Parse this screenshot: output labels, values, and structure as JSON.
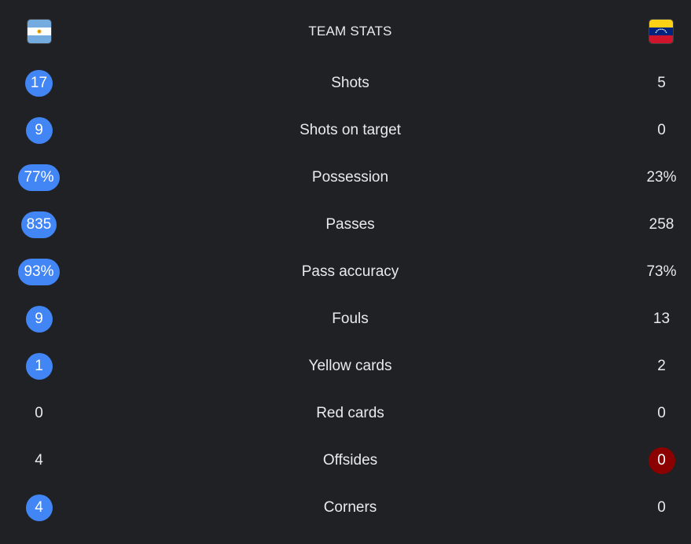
{
  "header": {
    "title": "TEAM STATS",
    "home_flag": "argentina-flag",
    "away_flag": "venezuela-flag"
  },
  "colors": {
    "background": "#202124",
    "text": "#e8eaed",
    "highlight_blue": "#4285f4",
    "highlight_red": "#8b0000"
  },
  "stats": [
    {
      "label": "Shots",
      "home": "17",
      "away": "5",
      "highlight": "home",
      "highlight_color": "blue"
    },
    {
      "label": "Shots on target",
      "home": "9",
      "away": "0",
      "highlight": "home",
      "highlight_color": "blue"
    },
    {
      "label": "Possession",
      "home": "77%",
      "away": "23%",
      "highlight": "home",
      "highlight_color": "blue"
    },
    {
      "label": "Passes",
      "home": "835",
      "away": "258",
      "highlight": "home",
      "highlight_color": "blue"
    },
    {
      "label": "Pass accuracy",
      "home": "93%",
      "away": "73%",
      "highlight": "home",
      "highlight_color": "blue"
    },
    {
      "label": "Fouls",
      "home": "9",
      "away": "13",
      "highlight": "home",
      "highlight_color": "blue"
    },
    {
      "label": "Yellow cards",
      "home": "1",
      "away": "2",
      "highlight": "home",
      "highlight_color": "blue"
    },
    {
      "label": "Red cards",
      "home": "0",
      "away": "0",
      "highlight": "none",
      "highlight_color": ""
    },
    {
      "label": "Offsides",
      "home": "4",
      "away": "0",
      "highlight": "away",
      "highlight_color": "red"
    },
    {
      "label": "Corners",
      "home": "4",
      "away": "0",
      "highlight": "home",
      "highlight_color": "blue"
    }
  ]
}
